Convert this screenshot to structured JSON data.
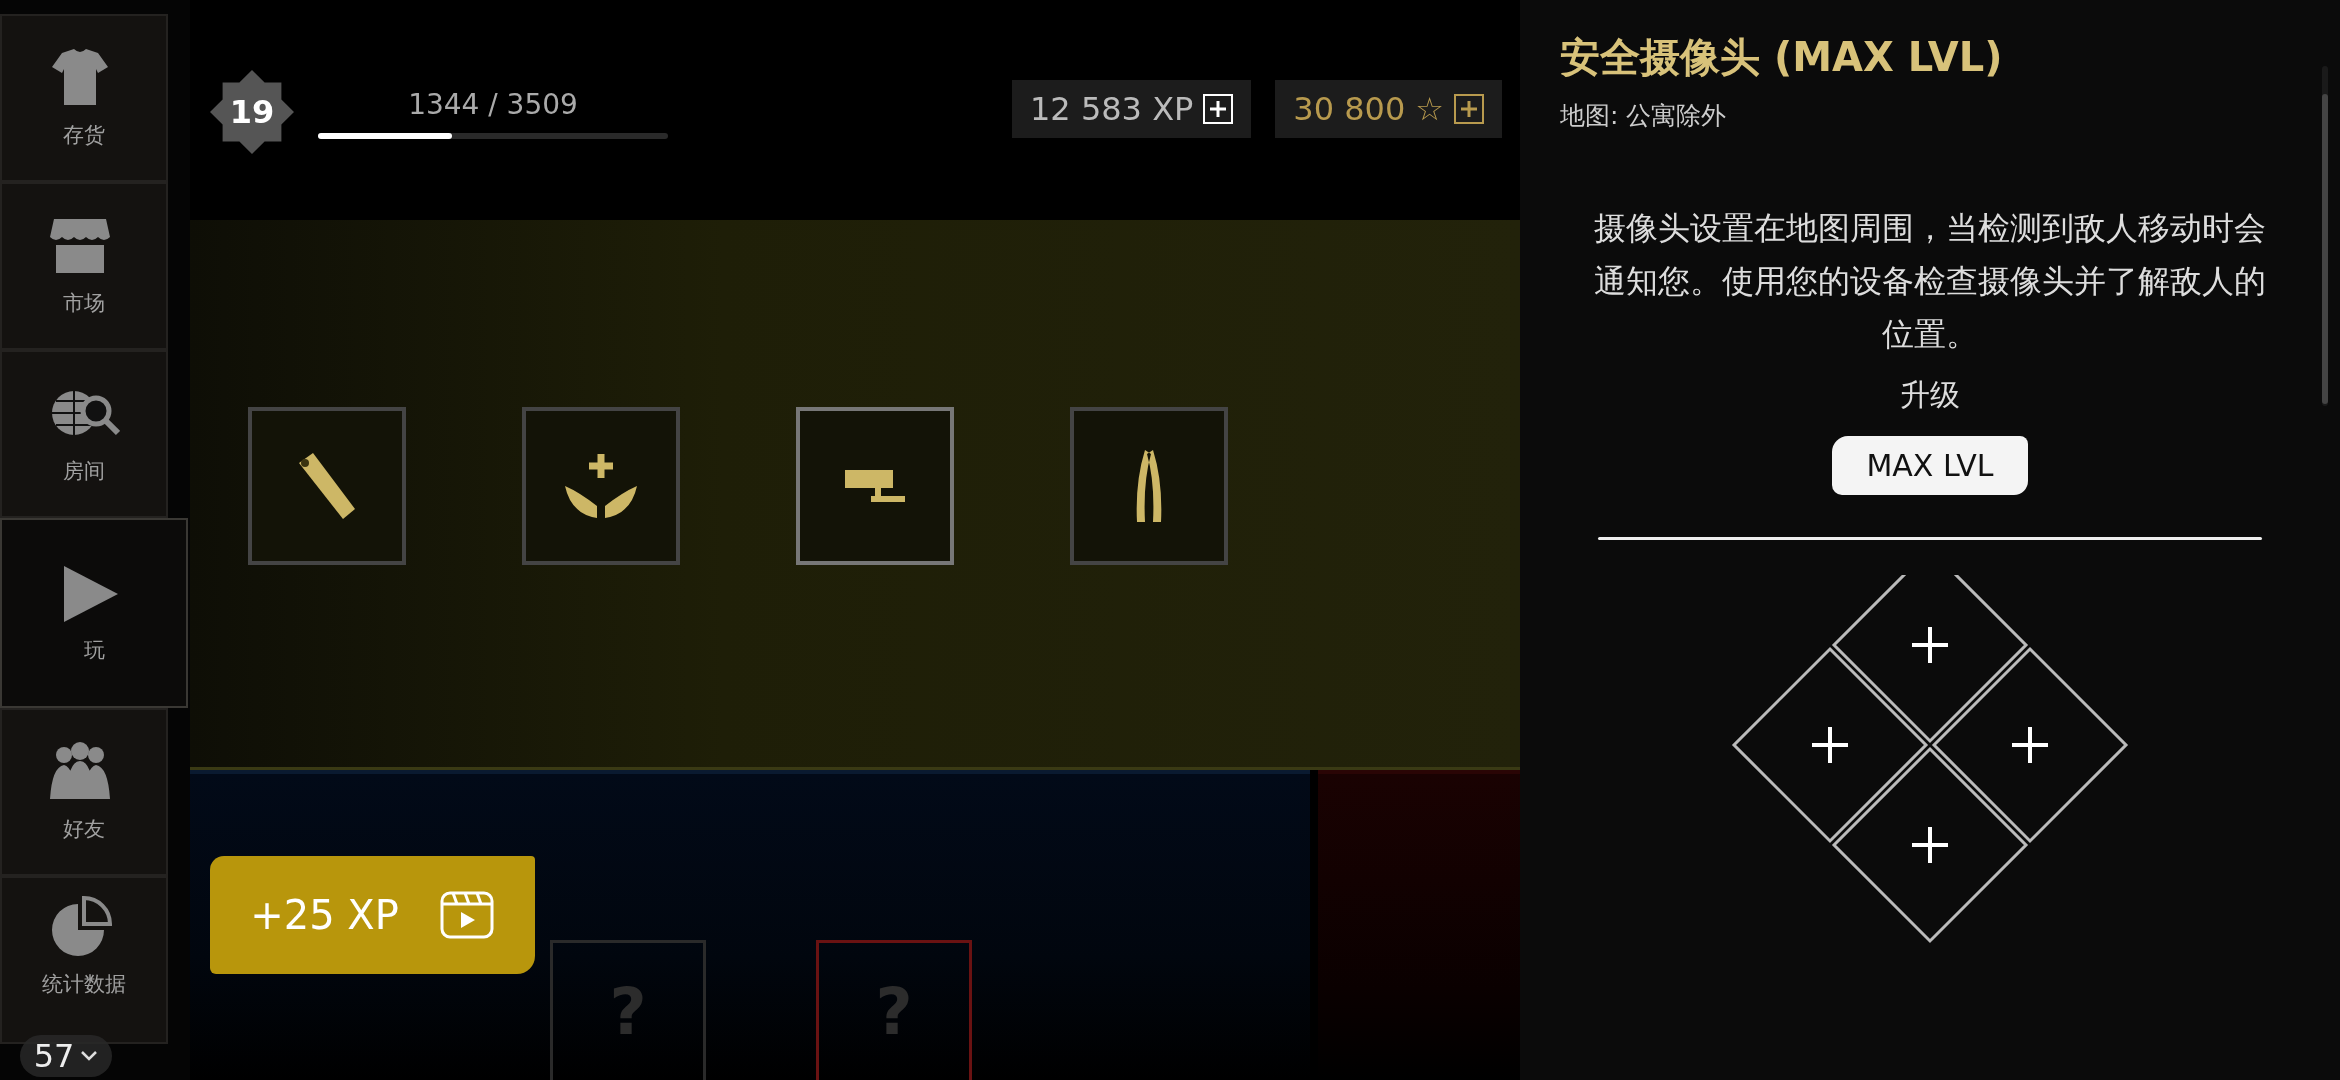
{
  "sidebar": {
    "items": [
      {
        "label": "存货",
        "kind": "shirt",
        "selected": false
      },
      {
        "label": "市场",
        "kind": "shop",
        "selected": false
      },
      {
        "label": "房间",
        "kind": "globe",
        "selected": false
      },
      {
        "label": "玩",
        "kind": "play",
        "selected": true
      },
      {
        "label": "好友",
        "kind": "people",
        "selected": false
      },
      {
        "label": "统计数据",
        "kind": "chart",
        "selected": false
      }
    ]
  },
  "player": {
    "rank": "19",
    "xp_text": "1344 / 3509",
    "xp_bar": {
      "level": 0.383
    }
  },
  "currencies": [
    {
      "amount": "12 583 XP",
      "kind": "xp"
    },
    {
      "amount": "30 800",
      "glyph": "☆",
      "kind": "stars"
    }
  ],
  "items": [
    {
      "kind": "flashlight",
      "selected": false
    },
    {
      "kind": "wings",
      "selected": false
    },
    {
      "kind": "camera",
      "selected": true
    },
    {
      "kind": "pliers",
      "selected": false
    }
  ],
  "mystery_cards": [
    {
      "mark": "?",
      "color": "#2a2a2a"
    },
    {
      "mark": "?",
      "color": "#6a1212"
    }
  ],
  "reward_button": {
    "label": "+25 XP"
  },
  "fps": {
    "value": "57"
  },
  "detail": {
    "title": "安全摄像头 (MAX LVL)",
    "map": "地图: 公寓除外",
    "description": "摄像头设置在地图周围，当检测到敌人移动时会通知您。使用您的设备检查摄像头并了解敌人的位置。",
    "upgrade_label": "升级",
    "upgrade_button": "MAX LVL",
    "slots": [
      {
        "kind": "empty"
      },
      {
        "kind": "empty"
      },
      {
        "kind": "empty"
      },
      {
        "kind": "empty"
      }
    ]
  }
}
